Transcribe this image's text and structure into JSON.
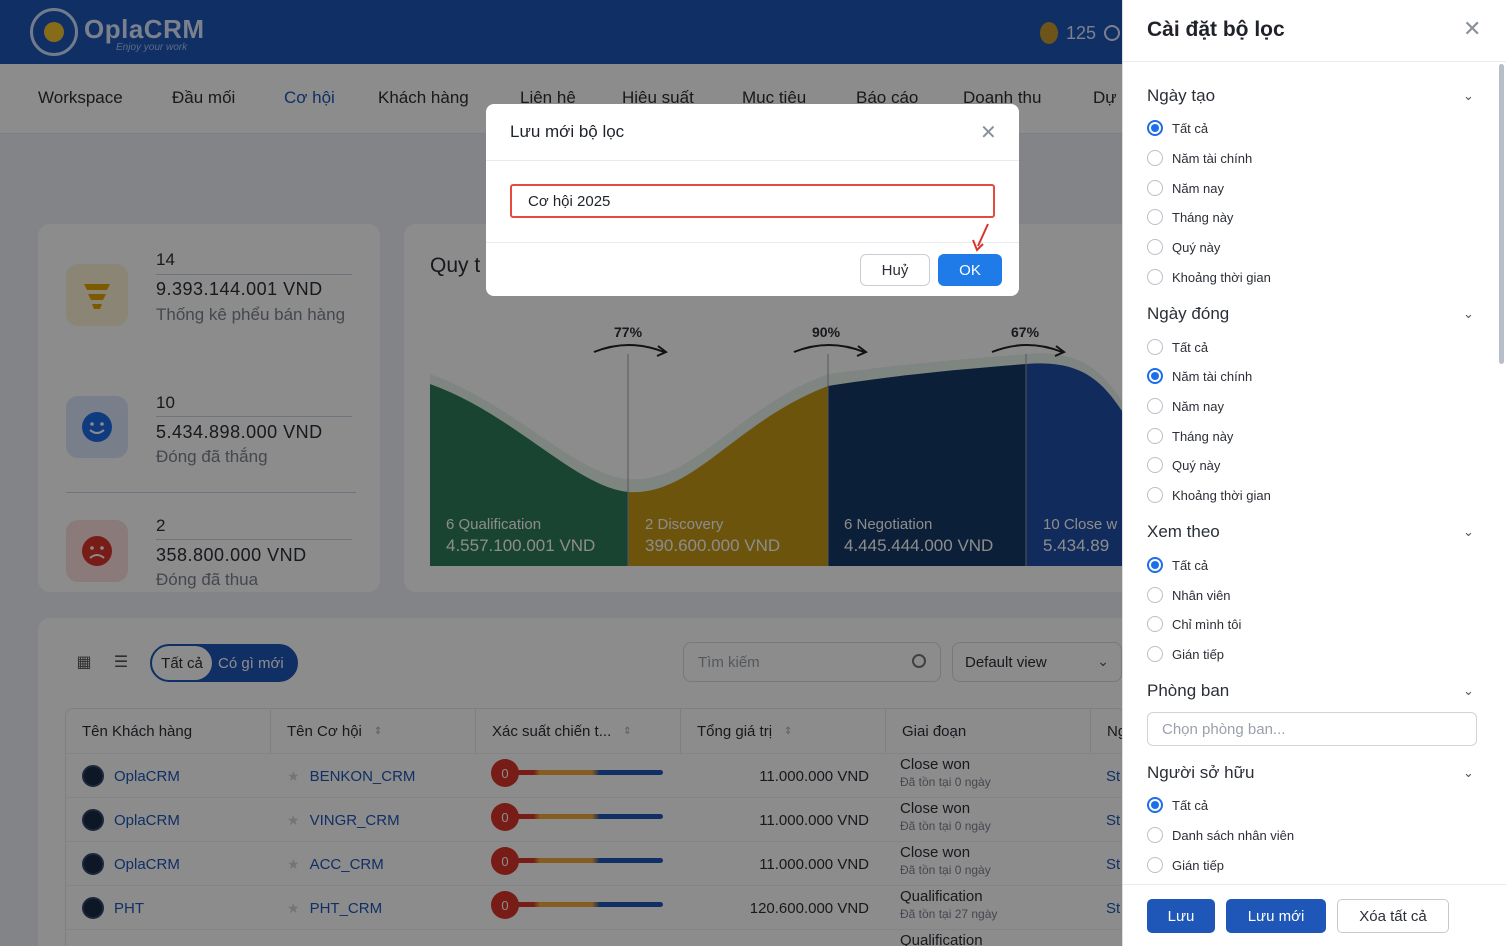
{
  "app": {
    "brand": "OplaCRM",
    "tagline": "Enjoy your work",
    "coins": "125"
  },
  "nav": [
    "Workspace",
    "Đầu mối",
    "Cơ hội",
    "Khách hàng",
    "Liên hệ",
    "Hiệu suất",
    "Mục tiêu",
    "Báo cáo",
    "Doanh thu",
    "Dự"
  ],
  "nav_active": "Cơ hội",
  "stats": [
    {
      "count": "14",
      "amount": "9.393.144.001 VND",
      "label": "Thống kê phểu bán hàng",
      "icon": "funnel-icon"
    },
    {
      "count": "10",
      "amount": "5.434.898.000 VND",
      "label": "Đóng đã thắng",
      "icon": "smile-icon"
    },
    {
      "count": "2",
      "amount": "358.800.000 VND",
      "label": "Đóng đã thua",
      "icon": "sad-icon"
    }
  ],
  "funnel": {
    "title": "Quy t",
    "rates": [
      "77%",
      "90%",
      "67%"
    ],
    "stages": [
      {
        "label": "6 Qualification",
        "value": "4.557.100.001 VND",
        "color": "#2e7d5b"
      },
      {
        "label": "2 Discovery",
        "value": "390.600.000 VND",
        "color": "#c79a16"
      },
      {
        "label": "6 Negotiation",
        "value": "4.445.444.000 VND",
        "color": "#173a66"
      },
      {
        "label": "10 Close w",
        "value": "5.434.89",
        "color": "#1e4fa8"
      }
    ]
  },
  "toolbar": {
    "seg_all": "Tất cả",
    "seg_new": "Có gì mới",
    "search_placeholder": "Tìm kiếm",
    "view": "Default view"
  },
  "table": {
    "headers": [
      "Tên Khách hàng",
      "Tên Cơ hội",
      "Xác suất chiến t...",
      "Tổng giá trị",
      "Giai đoạn",
      "Ng"
    ],
    "rows": [
      {
        "customer": "OplaCRM",
        "opportunity": "BENKON_CRM",
        "probability": "0",
        "total": "11.000.000 VND",
        "stage": "Close won",
        "stage_sub": "Đã tồn tại 0 ngày",
        "extra": "St"
      },
      {
        "customer": "OplaCRM",
        "opportunity": "VINGR_CRM",
        "probability": "0",
        "total": "11.000.000 VND",
        "stage": "Close won",
        "stage_sub": "Đã tồn tại 0 ngày",
        "extra": "St"
      },
      {
        "customer": "OplaCRM",
        "opportunity": "ACC_CRM",
        "probability": "0",
        "total": "11.000.000 VND",
        "stage": "Close won",
        "stage_sub": "Đã tồn tại 0 ngày",
        "extra": "St"
      },
      {
        "customer": "PHT",
        "opportunity": "PHT_CRM",
        "probability": "0",
        "total": "120.600.000 VND",
        "stage": "Qualification",
        "stage_sub": "Đã tồn tại 27 ngày",
        "extra": "St"
      },
      {
        "customer": "",
        "opportunity": "",
        "probability": "",
        "total": "",
        "stage": "Qualification",
        "stage_sub": "",
        "extra": ""
      }
    ]
  },
  "filter_panel": {
    "title": "Cài đặt bộ lọc",
    "sections": [
      {
        "title": "Ngày tạo",
        "options": [
          "Tất cả",
          "Năm tài chính",
          "Năm nay",
          "Tháng này",
          "Quý này",
          "Khoảng thời gian"
        ],
        "selected": 0
      },
      {
        "title": "Ngày đóng",
        "options": [
          "Tất cả",
          "Năm tài chính",
          "Năm nay",
          "Tháng này",
          "Quý này",
          "Khoảng thời gian"
        ],
        "selected": 1
      },
      {
        "title": "Xem theo",
        "options": [
          "Tất cả",
          "Nhân viên",
          "Chỉ mình tôi",
          "Gián tiếp"
        ],
        "selected": 0
      },
      {
        "title": "Phòng ban",
        "placeholder": "Chọn phòng ban..."
      },
      {
        "title": "Người sở hữu",
        "options": [
          "Tất cả",
          "Danh sách nhân viên",
          "Gián tiếp"
        ],
        "selected": 0
      }
    ],
    "buttons": {
      "save": "Lưu",
      "save_new": "Lưu mới",
      "clear": "Xóa tất cả"
    }
  },
  "modal": {
    "title": "Lưu mới bộ lọc",
    "input_value": "Cơ hội 2025",
    "cancel": "Huỷ",
    "ok": "OK"
  }
}
